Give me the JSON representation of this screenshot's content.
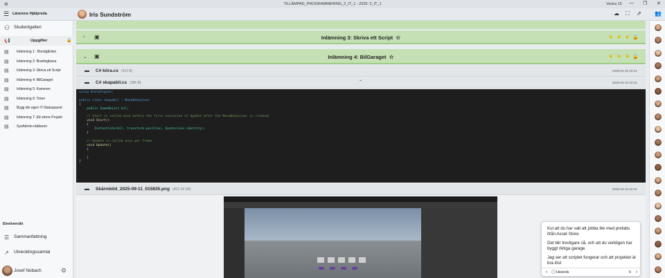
{
  "titlebar": {
    "title": "TILLÄMPAD_PROGRAMMERING_2_IT_1 - 2025: 2_IT_1",
    "week": "Vecka 15",
    "minimize": "—",
    "restore": "❐",
    "close": "✕"
  },
  "appbar": {
    "brand": "Lärarens Hjälpreda",
    "user": "Iris Sundström"
  },
  "sidebar": {
    "student_gallery": "Studentgalleri",
    "tasks_label": "Uppgifter",
    "items": [
      "Inlämning 1 : Bondgården",
      "Inlämning 2: Bowlingbana",
      "Inlämning 3: Skriva ett Script",
      "Inlämning 4: BilGaraget",
      "Inlämning 5: Kanonen",
      "Inlämning 6: Timer",
      "Bygg din egen IT-Statuspanel",
      "Inlämning 7: Ett större Projekt",
      "SysAdmin-räddaren"
    ],
    "overview_label": "Elevöversikt",
    "summary": "Sammanfattning",
    "dev_talk": "Utvecklingssamtal",
    "footer_user": "Josef Nobach"
  },
  "main": {
    "sub3": {
      "title": "Inlämning 3: Skriva ett Script"
    },
    "sub4": {
      "title": "Inlämning 4: BilGaraget"
    },
    "files": [
      {
        "name": "C# köra.cs",
        "size": "(415 B)",
        "date": "2025-04-10 22:41"
      },
      {
        "name": "C# skapabil.cs",
        "size": "(385 B)",
        "date": "2025-04-10 22:41"
      },
      {
        "name": "Skärmbild_2025-09-11_015835.png",
        "size": "(402.44 KB)",
        "date": "2025-04-10 22:41"
      }
    ],
    "code": {
      "l1": "using UnityEngine;",
      "l2": "public class skapabil : MonoBehaviour",
      "l3": "{",
      "l4": "    public GameObject bil;",
      "l5": "    // Start is called once before the first execution of Update after the MonoBehaviour is created",
      "l6": "    void Start()",
      "l7": "    {",
      "l8": "        Instantiate(bil, transform.position, Quaternion.identity);",
      "l9": "    }",
      "l10": "    // Update is called once per frame",
      "l11": "    void Update()",
      "l12": "    {",
      "l13": "    }",
      "l14": "}"
    }
  },
  "chat": {
    "m1": "Kul att du har valt att jobba lite med prefabs ifrån Asset Store.",
    "m2": "Det blir trevligare så, och att du verkligen har byggt riktiga garage.",
    "m3": "Jag ser att scriptet fungerar och att projektet är bra löst",
    "history": "Historik",
    "badge": "5",
    "next": "›"
  },
  "colors": {
    "green": "#c5e0b4",
    "code_bg": "#1e1e1e",
    "star": "#e6b800"
  }
}
